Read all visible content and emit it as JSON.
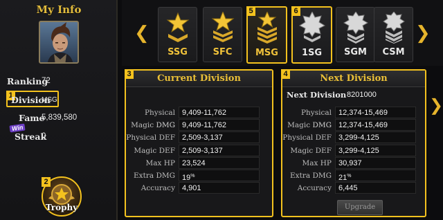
{
  "left_panel": {
    "title": "My Info",
    "ranking_label": "Ranking",
    "ranking_value": "72",
    "division_label": "Division",
    "division_value": "MSG",
    "fame_label": "Fame",
    "fame_value": "5,839,580",
    "win_badge": "Win",
    "streak_label": "Streak",
    "streak_value": "0",
    "trophy_label": "Trophy",
    "tag_division": "1",
    "tag_trophy": "2"
  },
  "ranks": [
    {
      "label": "SSG",
      "tier": "gold",
      "icon": "star-one-chevron-icon"
    },
    {
      "label": "SFC",
      "tier": "gold",
      "icon": "star-two-chevron-icon"
    },
    {
      "label": "MSG",
      "tier": "gold",
      "icon": "star-three-chevron-icon",
      "tag": "5"
    },
    {
      "label": "1SG",
      "tier": "silver",
      "icon": "silver-star-chevron-icon",
      "tag": "6"
    },
    {
      "label": "SGM",
      "tier": "silver",
      "icon": "silver-badge-two-chevron-icon"
    },
    {
      "label": "CSM",
      "tier": "silver",
      "icon": "silver-badge-three-chevron-icon"
    }
  ],
  "current_division": {
    "title": "Current Division",
    "tag": "3",
    "stats": [
      {
        "label": "Physical DMG",
        "value": "9,409-11,762"
      },
      {
        "label": "Magic DMG",
        "value": "9,409-11,762"
      },
      {
        "label": "Physical DEF",
        "value": "2,509-3,137"
      },
      {
        "label": "Magic DEF",
        "value": "2,509-3,137"
      },
      {
        "label": "Max HP",
        "value": "23,524"
      },
      {
        "label": "Extra DMG",
        "value": "19",
        "suffix": "%"
      },
      {
        "label": "Accuracy",
        "value": "4,901"
      }
    ]
  },
  "next_division": {
    "title": "Next Division",
    "tag": "4",
    "label": "Next Division",
    "value": "8201000",
    "stats": [
      {
        "label": "Physical DMG",
        "value": "12,374-15,469"
      },
      {
        "label": "Magic DMG",
        "value": "12,374-15,469"
      },
      {
        "label": "Physical DEF",
        "value": "3,299-4,125"
      },
      {
        "label": "Magic DEF",
        "value": "3,299-4,125"
      },
      {
        "label": "Max HP",
        "value": "30,937"
      },
      {
        "label": "Extra DMG",
        "value": "21",
        "suffix": "%"
      },
      {
        "label": "Accuracy",
        "value": "6,445"
      }
    ],
    "upgrade_label": "Upgrade"
  },
  "colors": {
    "accent_gold": "#f4c21e",
    "header_gold": "#e9bf38",
    "panel_bg": "#18181a"
  }
}
